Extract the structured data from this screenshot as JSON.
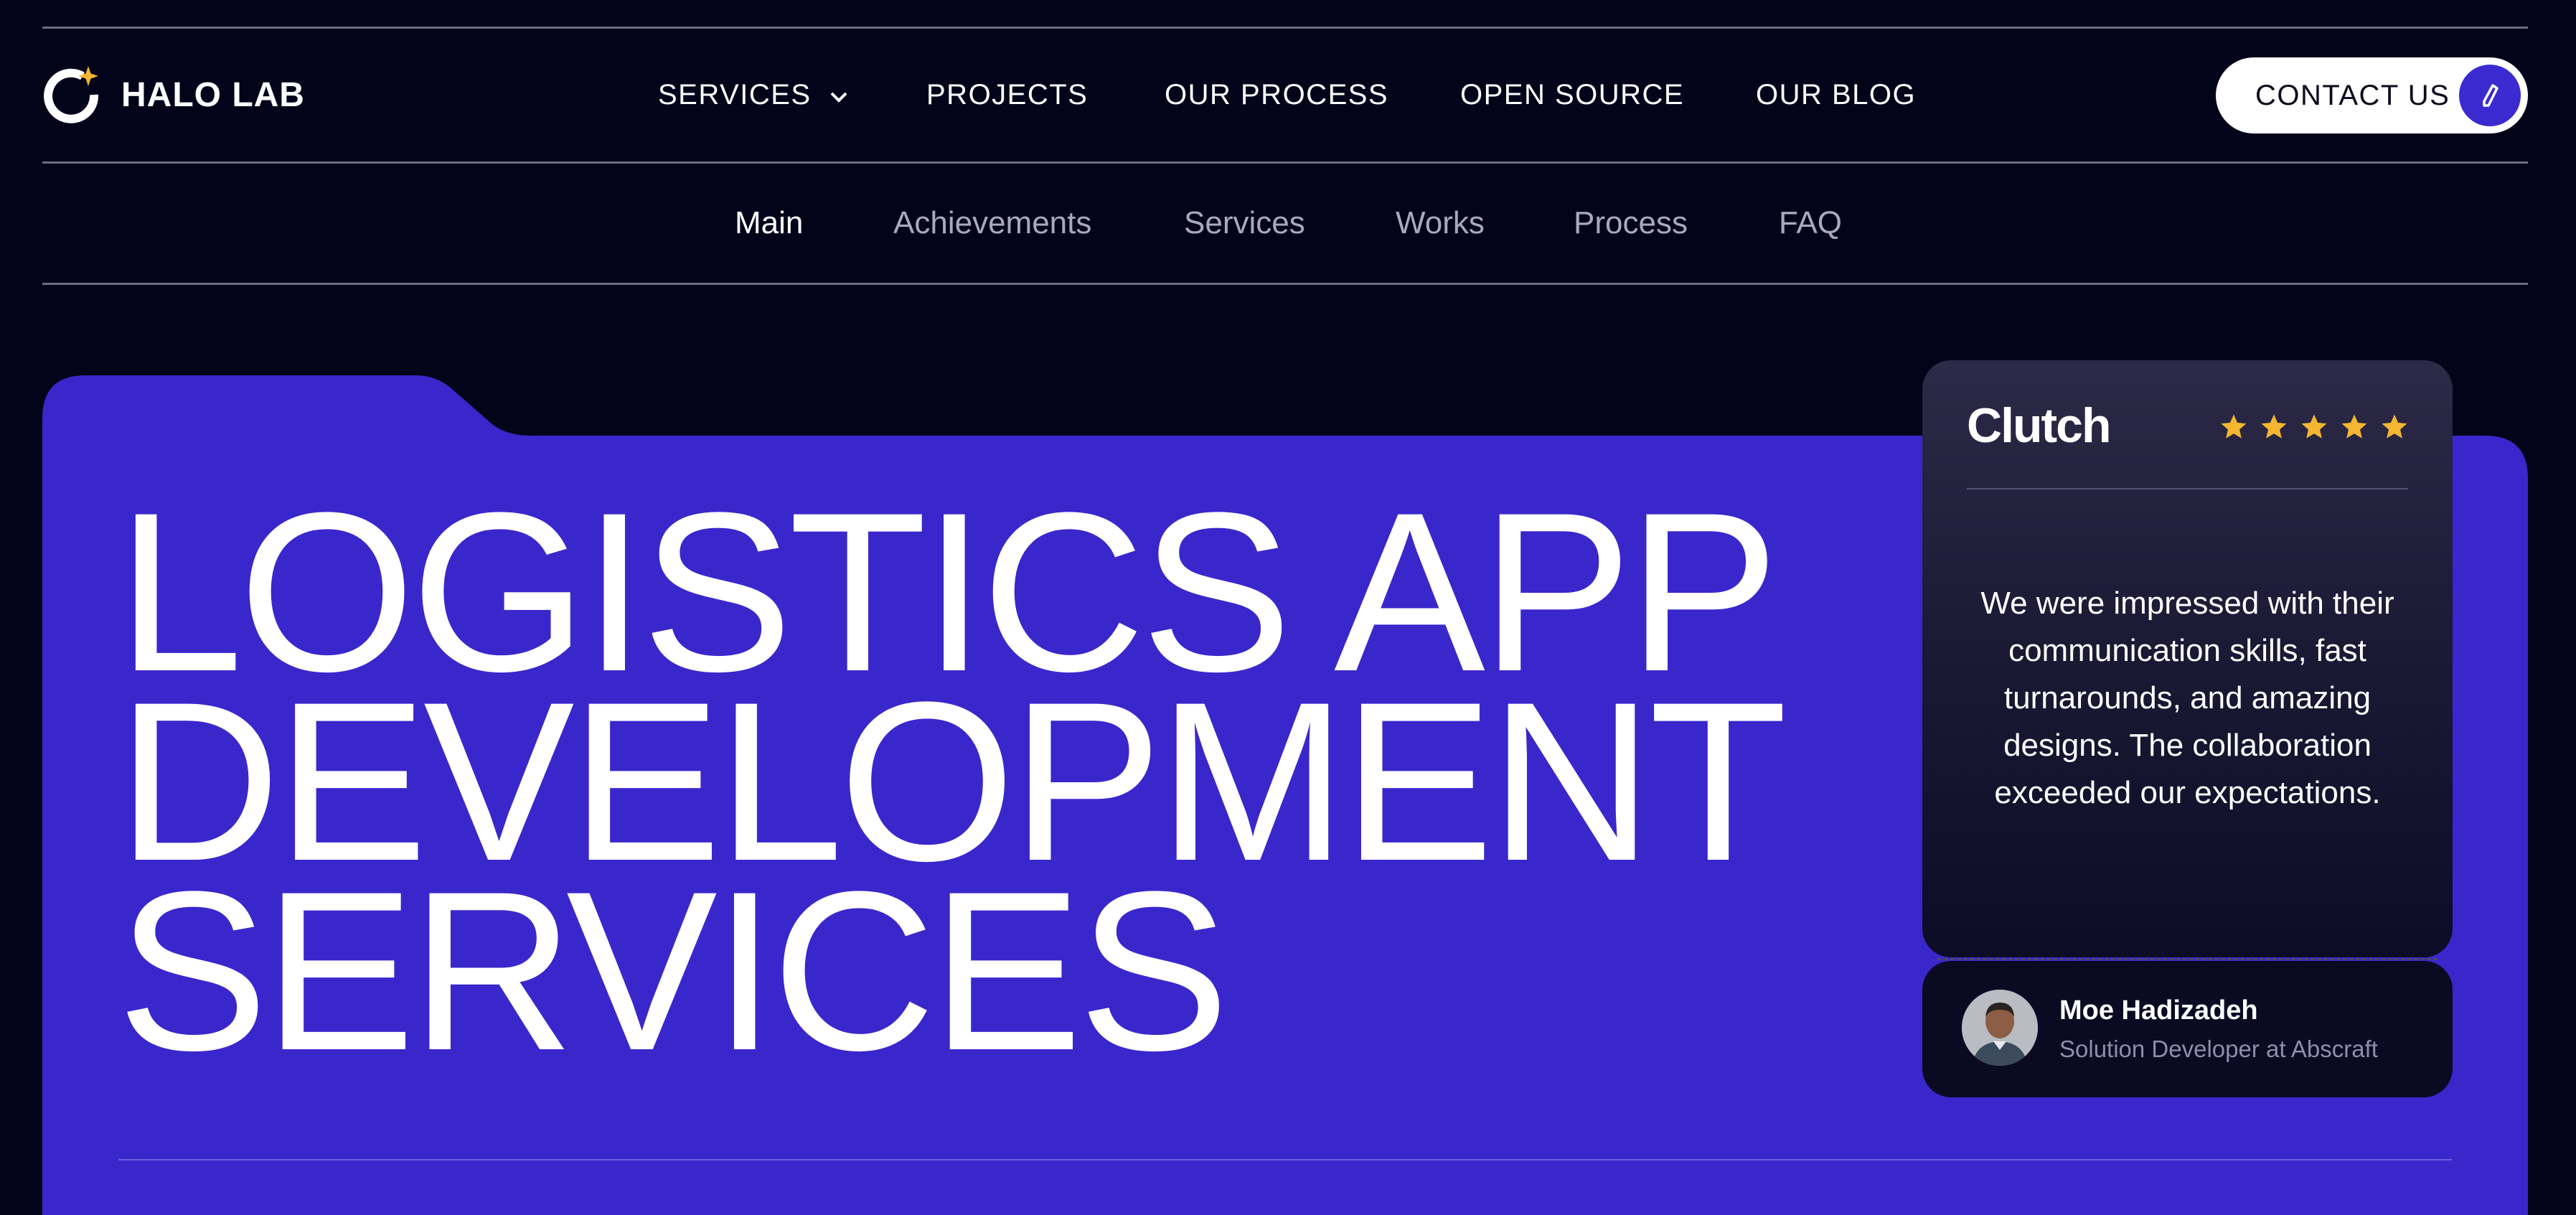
{
  "brand": {
    "name": "HALO LAB",
    "mark_color": "#ffffff",
    "spark_color": "#f5b731"
  },
  "nav": {
    "items": [
      {
        "label": "SERVICES",
        "has_dropdown": true
      },
      {
        "label": "PROJECTS"
      },
      {
        "label": "OUR PROCESS"
      },
      {
        "label": "OPEN SOURCE"
      },
      {
        "label": "OUR BLOG"
      }
    ],
    "contact": {
      "label": "CONTACT US",
      "icon": "pencil-icon"
    }
  },
  "subnav": {
    "items": [
      {
        "label": "Main",
        "active": true
      },
      {
        "label": "Achievements"
      },
      {
        "label": "Services"
      },
      {
        "label": "Works"
      },
      {
        "label": "Process"
      },
      {
        "label": "FAQ"
      }
    ]
  },
  "hero": {
    "title_lines": [
      "LOGISTICS APP",
      "DEVELOPMENT",
      "SERVICES"
    ],
    "background": "#3a27cc"
  },
  "review": {
    "source": "Clutch",
    "rating": 5,
    "star_color": "#f5b731",
    "quote": "We were impressed with their communication skills, fast turnarounds, and amazing designs. The collaboration exceeded our expectations.",
    "author": {
      "name": "Moe Hadizadeh",
      "role": "Solution Developer at Abscraft"
    }
  },
  "colors": {
    "page_bg": "#03041a",
    "accent": "#3a27cc"
  }
}
